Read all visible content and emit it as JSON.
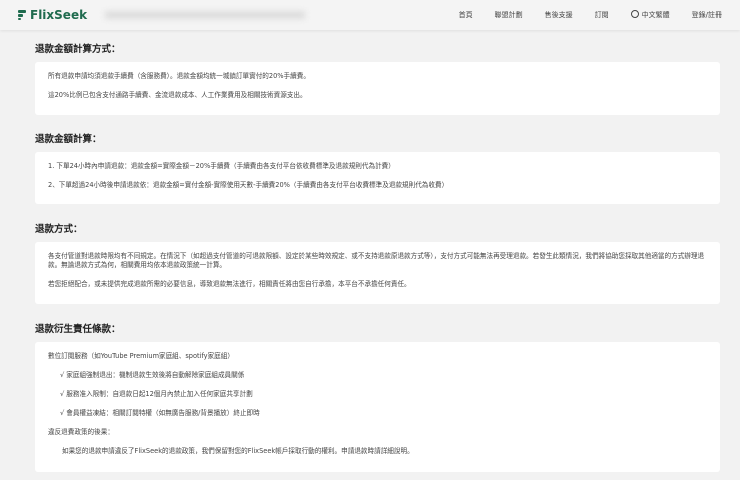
{
  "header": {
    "brand": "FlixSeek",
    "nav": [
      "首頁",
      "聯盟計劃",
      "售後支援",
      "訂閱",
      "中文繁體",
      "登錄/註冊"
    ]
  },
  "sections": [
    {
      "title": "退款金額計算方式：",
      "paras": [
        "所有退款申請均須退款手續費（含服務費）。退款金額均統一城鎮訂單實付的20%手續費。",
        "這20%比例已包含支付通路手續費、金流退款成本、人工作業費用及相關技術資源支出。"
      ]
    },
    {
      "title": "退款金額計算：",
      "paras": [
        "1. 下單24小時內申請退款：退款金額=實際金額－20%手續費（手續費由各支付平台依收費標準及退款規則代為計費）",
        "2、下單超過24小時後申請退款依：退款金額=實付金額-實際使用天數-手續費20%（手續費由各支付平台收費標準及退款規則代為收費）"
      ]
    },
    {
      "title": "退款方式：",
      "paras": [
        "各支付管道對退款時限均有不同規定。在情況下（如超過支付管道的可退款限額、設定於某些時效規定、或不支持退款原退款方式等），支付方式可能無法再受理退款。若發生此類情況，我們將協助您採取其他適當的方式辦理退款。無論退款方式為何，相關費用均依本退款政策統一計算。",
        "若您拒絕配合，或未提供完成退款所需的必要信息，導致退款無法進行，相關責任將由您自行承擔，本平台不承擔任何責任。"
      ]
    },
    {
      "title": "退款衍生責任條款：",
      "paras": [
        "數位訂閱服務（如YouTube Premium家庭組、spotify家庭組）",
        "√ 家庭組強制退出：機制退款生效後將自動解除家庭組成員關係",
        "√ 服務准入限制：自退款日起12個月內禁止加入任何家庭共享計劃",
        "√ 會員權益凍結：相關訂閱特權（如無廣告服務/背景播放）終止即時",
        "違反退費政策的後果：",
        "如果您的退款申請違反了FlixSeek的退款政策，我們保留對您的FlixSeek帳戶採取行動的權利。申請退款時請詳細說明。"
      ]
    }
  ]
}
